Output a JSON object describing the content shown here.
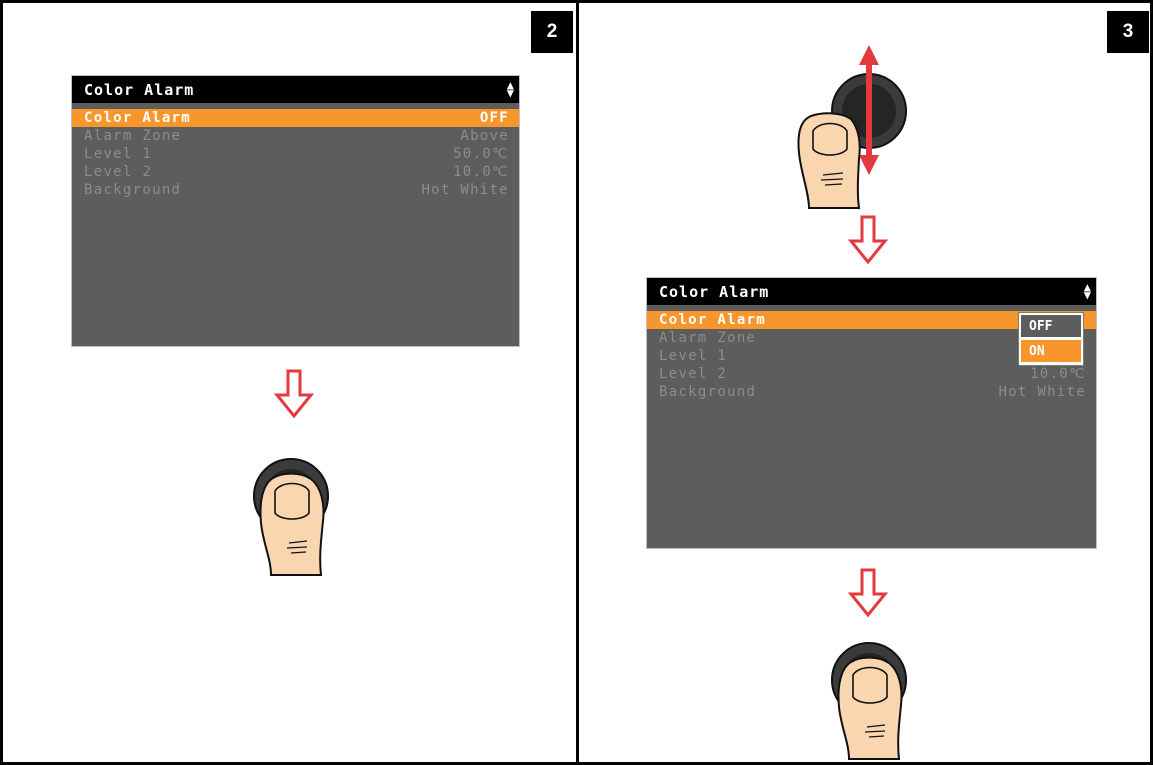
{
  "steps": [
    {
      "number": "2",
      "screen": {
        "title": "Color Alarm",
        "rows": [
          {
            "label": "Color Alarm",
            "value": "OFF"
          },
          {
            "label": "Alarm Zone",
            "value": "Above"
          },
          {
            "label": "Level 1",
            "value": "50.0℃"
          },
          {
            "label": "Level 2",
            "value": "10.0℃"
          },
          {
            "label": "Background",
            "value": "Hot White"
          }
        ]
      }
    },
    {
      "number": "3",
      "screen": {
        "title": "Color Alarm",
        "rows": [
          {
            "label": "Color Alarm",
            "value": ""
          },
          {
            "label": "Alarm Zone",
            "value": ""
          },
          {
            "label": "Level 1",
            "value": ""
          },
          {
            "label": "Level 2",
            "value": "10.0℃"
          },
          {
            "label": "Background",
            "value": "Hot White"
          }
        ],
        "popup": {
          "options": [
            "OFF",
            "ON"
          ],
          "selected": "ON"
        }
      }
    }
  ],
  "colors": {
    "highlight": "#f7962a",
    "screen_bg": "#5d5d5b",
    "arrow": "#e23a3f"
  },
  "icons": [
    "joystick-press-icon",
    "joystick-up-down-icon",
    "down-arrow-icon"
  ]
}
